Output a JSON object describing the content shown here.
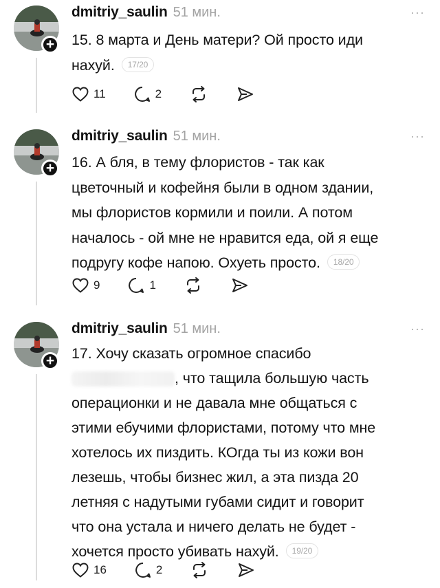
{
  "posts": [
    {
      "username": "dmitriy_saulin",
      "time": "51 мин.",
      "more": "···",
      "lines": [
        "15. 8 марта и День матери? Ой просто иди",
        "нахуй."
      ],
      "counter": "17/20",
      "likes": "11",
      "comments": "2"
    },
    {
      "username": "dmitriy_saulin",
      "time": "51 мин.",
      "more": "···",
      "lines": [
        "16. А бля, в тему флористов - так как",
        "цветочный и кофейня были в одном здании,",
        "мы флористов кормили и поили. А потом",
        "началось - ой мне не нравится еда, ой я еще",
        "подругу кофе напою. Охуеть просто."
      ],
      "counter": "18/20",
      "likes": "9",
      "comments": "1"
    },
    {
      "username": "dmitriy_saulin",
      "time": "51 мин.",
      "more": "···",
      "lines": [
        "17. Хочу сказать огромное спасибо",
        ", что тащила большую часть",
        "операционки и не давала мне общаться с",
        "этими ебучими флористами, потому что мне",
        "хотелось их пиздить. КОгда ты из кожи вон",
        "лезешь, чтобы бизнес жил, а эта пизда 20",
        "летняя с надутыми губами сидит и говорит",
        "что она устала и ничего делать не будет -",
        "хочется просто убивать нахуй."
      ],
      "counter": "19/20",
      "likes": "16",
      "comments": "2"
    }
  ],
  "icons": {
    "like": "heart-icon",
    "comment": "comment-icon",
    "repost": "repost-icon",
    "share": "send-icon",
    "follow": "plus-icon"
  }
}
